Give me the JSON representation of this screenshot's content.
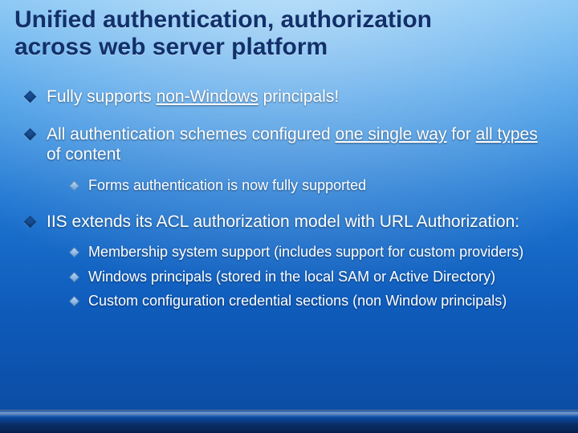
{
  "title_line1": "Unified authentication, authorization",
  "title_line2": "across web server platform",
  "bullets": [
    {
      "segments": [
        {
          "t": "Fully supports ",
          "u": false
        },
        {
          "t": "non-Windows",
          "u": true
        },
        {
          "t": " principals!",
          "u": false
        }
      ]
    },
    {
      "segments": [
        {
          "t": "All authentication schemes configured ",
          "u": false
        },
        {
          "t": "one single way",
          "u": true
        },
        {
          "t": " for ",
          "u": false
        },
        {
          "t": "all types",
          "u": true
        },
        {
          "t": " of content",
          "u": false
        }
      ],
      "sub": [
        {
          "segments": [
            {
              "t": "Forms authentication is now fully supported",
              "u": false
            }
          ]
        }
      ]
    },
    {
      "segments": [
        {
          "t": "IIS extends its ACL authorization model with URL Authorization:",
          "u": false
        }
      ],
      "sub": [
        {
          "segments": [
            {
              "t": "Membership system support (includes support for custom providers)",
              "u": false
            }
          ]
        },
        {
          "segments": [
            {
              "t": "Windows principals (stored in the local SAM or Active Directory)",
              "u": false
            }
          ]
        },
        {
          "segments": [
            {
              "t": "Custom configuration credential sections (non Window principals)",
              "u": false
            }
          ]
        }
      ]
    }
  ]
}
